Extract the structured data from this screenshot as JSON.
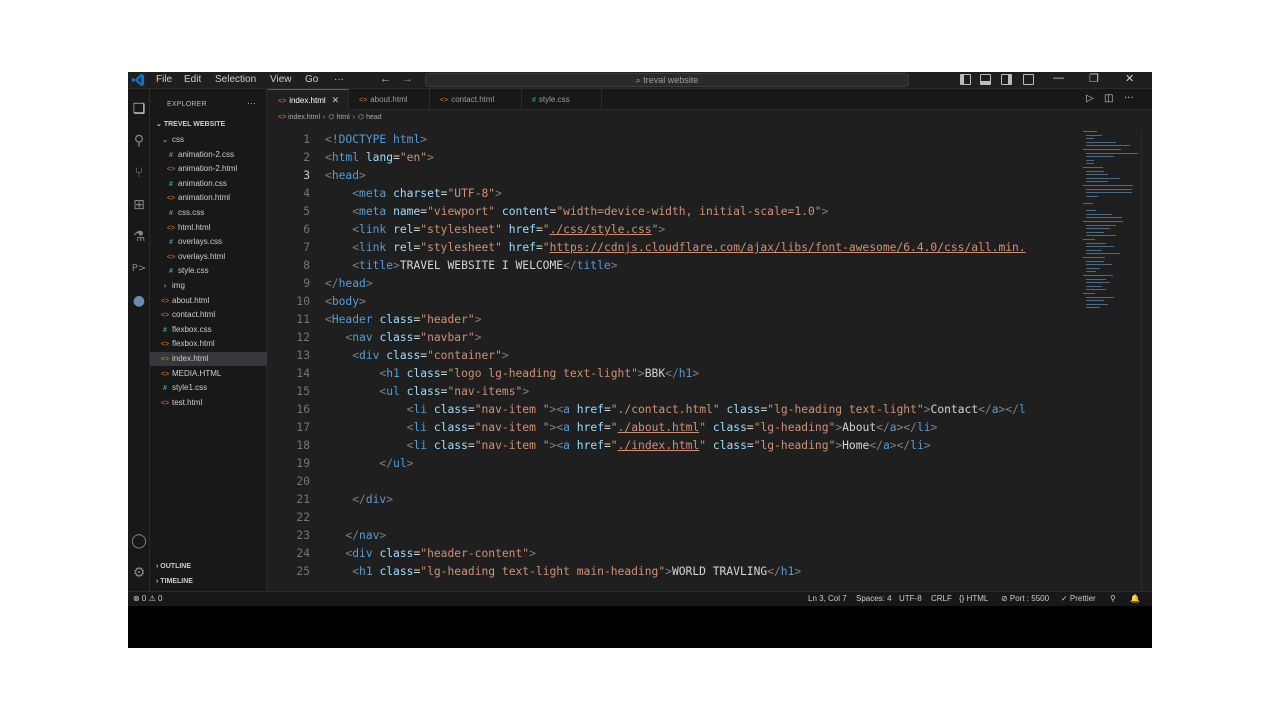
{
  "titlebar": {
    "menu": [
      "File",
      "Edit",
      "Selection",
      "View",
      "Go",
      "···"
    ],
    "search": "treval website"
  },
  "sidebar": {
    "header": "EXPLORER",
    "more": "···",
    "project": "TREVEL WEBSITE",
    "tree": [
      {
        "name": "css",
        "kind": "folder",
        "indent": 1
      },
      {
        "name": "animation-2.css",
        "kind": "css",
        "indent": 2
      },
      {
        "name": "animation-2.html",
        "kind": "html",
        "indent": 2
      },
      {
        "name": "animation.css",
        "kind": "css",
        "indent": 2
      },
      {
        "name": "animation.html",
        "kind": "html",
        "indent": 2
      },
      {
        "name": "css.css",
        "kind": "css",
        "indent": 2
      },
      {
        "name": "html.html",
        "kind": "html",
        "indent": 2
      },
      {
        "name": "overlays.css",
        "kind": "css",
        "indent": 2
      },
      {
        "name": "overlays.html",
        "kind": "html",
        "indent": 2
      },
      {
        "name": "style.css",
        "kind": "css",
        "indent": 2
      },
      {
        "name": "img",
        "kind": "folder-closed",
        "indent": 1
      },
      {
        "name": "about.html",
        "kind": "html",
        "indent": 1
      },
      {
        "name": "contact.html",
        "kind": "html",
        "indent": 1
      },
      {
        "name": "flexbox.css",
        "kind": "css",
        "indent": 1
      },
      {
        "name": "flexbox.html",
        "kind": "html",
        "indent": 1
      },
      {
        "name": "index.html",
        "kind": "html",
        "indent": 1,
        "selected": true
      },
      {
        "name": "MEDIA.HTML",
        "kind": "html",
        "indent": 1
      },
      {
        "name": "style1.css",
        "kind": "css",
        "indent": 1
      },
      {
        "name": "test.html",
        "kind": "html",
        "indent": 1
      }
    ],
    "outline": "OUTLINE",
    "timeline": "TIMELINE"
  },
  "tabs": [
    {
      "label": "index.html",
      "kind": "html",
      "active": true
    },
    {
      "label": "about.html",
      "kind": "html"
    },
    {
      "label": "contact.html",
      "kind": "html"
    },
    {
      "label": "style.css",
      "kind": "css"
    }
  ],
  "breadcrumb": [
    "index.html",
    "html",
    "head"
  ],
  "code": {
    "current_line": 3,
    "lines": [
      [
        [
          "br",
          "<"
        ],
        [
          "tag",
          "!DOCTYPE"
        ],
        [
          "txt",
          " "
        ],
        [
          "tag",
          "html"
        ],
        [
          "br",
          ">"
        ]
      ],
      [
        [
          "br",
          "<"
        ],
        [
          "tag",
          "html"
        ],
        [
          "txt",
          " "
        ],
        [
          "attr",
          "lang"
        ],
        [
          "txt",
          "="
        ],
        [
          "str",
          "\"en\""
        ],
        [
          "br",
          ">"
        ]
      ],
      [
        [
          "br",
          "<"
        ],
        [
          "tag",
          "head"
        ],
        [
          "br",
          ">"
        ]
      ],
      [
        [
          "txt",
          "    "
        ],
        [
          "br",
          "<"
        ],
        [
          "tag",
          "meta"
        ],
        [
          "txt",
          " "
        ],
        [
          "attr",
          "charset"
        ],
        [
          "txt",
          "="
        ],
        [
          "str",
          "\"UTF-8\""
        ],
        [
          "br",
          ">"
        ]
      ],
      [
        [
          "txt",
          "    "
        ],
        [
          "br",
          "<"
        ],
        [
          "tag",
          "meta"
        ],
        [
          "txt",
          " "
        ],
        [
          "attr",
          "name"
        ],
        [
          "txt",
          "="
        ],
        [
          "str",
          "\"viewport\""
        ],
        [
          "txt",
          " "
        ],
        [
          "attr",
          "content"
        ],
        [
          "txt",
          "="
        ],
        [
          "str",
          "\"width=device-width, initial-scale=1.0\""
        ],
        [
          "br",
          ">"
        ]
      ],
      [
        [
          "txt",
          "    "
        ],
        [
          "br",
          "<"
        ],
        [
          "tag",
          "link"
        ],
        [
          "txt",
          " "
        ],
        [
          "attr",
          "rel"
        ],
        [
          "txt",
          "="
        ],
        [
          "str",
          "\"stylesheet\""
        ],
        [
          "txt",
          " "
        ],
        [
          "attr",
          "href"
        ],
        [
          "txt",
          "="
        ],
        [
          "str",
          "\""
        ],
        [
          "strul",
          "./css/style.css"
        ],
        [
          "str",
          "\""
        ],
        [
          "br",
          ">"
        ]
      ],
      [
        [
          "txt",
          "    "
        ],
        [
          "br",
          "<"
        ],
        [
          "tag",
          "link"
        ],
        [
          "txt",
          " "
        ],
        [
          "attr",
          "rel"
        ],
        [
          "txt",
          "="
        ],
        [
          "str",
          "\"stylesheet\""
        ],
        [
          "txt",
          " "
        ],
        [
          "attr",
          "href"
        ],
        [
          "txt",
          "="
        ],
        [
          "str",
          "\""
        ],
        [
          "strul",
          "https://cdnjs.cloudflare.com/ajax/libs/font-awesome/6.4.0/css/all.min."
        ]
      ],
      [
        [
          "txt",
          "    "
        ],
        [
          "br",
          "<"
        ],
        [
          "tag",
          "title"
        ],
        [
          "br",
          ">"
        ],
        [
          "txt",
          "TRAVEL WEBSITE I WELCOME"
        ],
        [
          "br",
          "</"
        ],
        [
          "tag",
          "title"
        ],
        [
          "br",
          ">"
        ]
      ],
      [
        [
          "br",
          "</"
        ],
        [
          "tag",
          "head"
        ],
        [
          "br",
          ">"
        ]
      ],
      [
        [
          "br",
          "<"
        ],
        [
          "tag",
          "body"
        ],
        [
          "br",
          ">"
        ]
      ],
      [
        [
          "br",
          "<"
        ],
        [
          "tag",
          "Header"
        ],
        [
          "txt",
          " "
        ],
        [
          "attr",
          "class"
        ],
        [
          "txt",
          "="
        ],
        [
          "str",
          "\"header\""
        ],
        [
          "br",
          ">"
        ]
      ],
      [
        [
          "txt",
          "   "
        ],
        [
          "br",
          "<"
        ],
        [
          "tag",
          "nav"
        ],
        [
          "txt",
          " "
        ],
        [
          "attr",
          "class"
        ],
        [
          "txt",
          "="
        ],
        [
          "str",
          "\"navbar\""
        ],
        [
          "br",
          ">"
        ]
      ],
      [
        [
          "txt",
          "    "
        ],
        [
          "br",
          "<"
        ],
        [
          "tag",
          "div"
        ],
        [
          "txt",
          " "
        ],
        [
          "attr",
          "class"
        ],
        [
          "txt",
          "="
        ],
        [
          "str",
          "\"container\""
        ],
        [
          "br",
          ">"
        ]
      ],
      [
        [
          "txt",
          "        "
        ],
        [
          "br",
          "<"
        ],
        [
          "tag",
          "h1"
        ],
        [
          "txt",
          " "
        ],
        [
          "attr",
          "class"
        ],
        [
          "txt",
          "="
        ],
        [
          "str",
          "\"logo lg-heading text-light\""
        ],
        [
          "br",
          ">"
        ],
        [
          "txt",
          "BBK"
        ],
        [
          "br",
          "</"
        ],
        [
          "tag",
          "h1"
        ],
        [
          "br",
          ">"
        ]
      ],
      [
        [
          "txt",
          "        "
        ],
        [
          "br",
          "<"
        ],
        [
          "tag",
          "ul"
        ],
        [
          "txt",
          " "
        ],
        [
          "attr",
          "class"
        ],
        [
          "txt",
          "="
        ],
        [
          "str",
          "\"nav-items\""
        ],
        [
          "br",
          ">"
        ]
      ],
      [
        [
          "txt",
          "            "
        ],
        [
          "br",
          "<"
        ],
        [
          "tag",
          "li"
        ],
        [
          "txt",
          " "
        ],
        [
          "attr",
          "class"
        ],
        [
          "txt",
          "="
        ],
        [
          "str",
          "\"nav-item \""
        ],
        [
          "br",
          ">"
        ],
        [
          "br",
          "<"
        ],
        [
          "tag",
          "a"
        ],
        [
          "txt",
          " "
        ],
        [
          "attr",
          "href"
        ],
        [
          "txt",
          "="
        ],
        [
          "str",
          "\"./contact.html\""
        ],
        [
          "txt",
          " "
        ],
        [
          "attr",
          "class"
        ],
        [
          "txt",
          "="
        ],
        [
          "str",
          "\"lg-heading text-light\""
        ],
        [
          "br",
          ">"
        ],
        [
          "txt",
          "Contact"
        ],
        [
          "br",
          "</"
        ],
        [
          "tag",
          "a"
        ],
        [
          "br",
          "></"
        ],
        [
          "tag",
          "l"
        ]
      ],
      [
        [
          "txt",
          "            "
        ],
        [
          "br",
          "<"
        ],
        [
          "tag",
          "li"
        ],
        [
          "txt",
          " "
        ],
        [
          "attr",
          "class"
        ],
        [
          "txt",
          "="
        ],
        [
          "str",
          "\"nav-item \""
        ],
        [
          "br",
          ">"
        ],
        [
          "br",
          "<"
        ],
        [
          "tag",
          "a"
        ],
        [
          "txt",
          " "
        ],
        [
          "attr",
          "href"
        ],
        [
          "txt",
          "="
        ],
        [
          "str",
          "\""
        ],
        [
          "strul",
          "./about.html"
        ],
        [
          "str",
          "\""
        ],
        [
          "txt",
          " "
        ],
        [
          "attr",
          "class"
        ],
        [
          "txt",
          "="
        ],
        [
          "str",
          "\"lg-heading\""
        ],
        [
          "br",
          ">"
        ],
        [
          "txt",
          "About"
        ],
        [
          "br",
          "</"
        ],
        [
          "tag",
          "a"
        ],
        [
          "br",
          "></"
        ],
        [
          "tag",
          "li"
        ],
        [
          "br",
          ">"
        ]
      ],
      [
        [
          "txt",
          "            "
        ],
        [
          "br",
          "<"
        ],
        [
          "tag",
          "li"
        ],
        [
          "txt",
          " "
        ],
        [
          "attr",
          "class"
        ],
        [
          "txt",
          "="
        ],
        [
          "str",
          "\"nav-item \""
        ],
        [
          "br",
          ">"
        ],
        [
          "br",
          "<"
        ],
        [
          "tag",
          "a"
        ],
        [
          "txt",
          " "
        ],
        [
          "attr",
          "href"
        ],
        [
          "txt",
          "="
        ],
        [
          "str",
          "\""
        ],
        [
          "strul",
          "./index.html"
        ],
        [
          "str",
          "\""
        ],
        [
          "txt",
          " "
        ],
        [
          "attr",
          "class"
        ],
        [
          "txt",
          "="
        ],
        [
          "str",
          "\"lg-heading\""
        ],
        [
          "br",
          ">"
        ],
        [
          "txt",
          "Home"
        ],
        [
          "br",
          "</"
        ],
        [
          "tag",
          "a"
        ],
        [
          "br",
          "></"
        ],
        [
          "tag",
          "li"
        ],
        [
          "br",
          ">"
        ]
      ],
      [
        [
          "txt",
          "        "
        ],
        [
          "br",
          "</"
        ],
        [
          "tag",
          "ul"
        ],
        [
          "br",
          ">"
        ]
      ],
      [
        [
          "txt",
          ""
        ]
      ],
      [
        [
          "txt",
          "    "
        ],
        [
          "br",
          "</"
        ],
        [
          "tag",
          "div"
        ],
        [
          "br",
          ">"
        ]
      ],
      [
        [
          "txt",
          ""
        ]
      ],
      [
        [
          "txt",
          "   "
        ],
        [
          "br",
          "</"
        ],
        [
          "tag",
          "nav"
        ],
        [
          "br",
          ">"
        ]
      ],
      [
        [
          "txt",
          "   "
        ],
        [
          "br",
          "<"
        ],
        [
          "tag",
          "div"
        ],
        [
          "txt",
          " "
        ],
        [
          "attr",
          "class"
        ],
        [
          "txt",
          "="
        ],
        [
          "str",
          "\"header-content\""
        ],
        [
          "br",
          ">"
        ]
      ],
      [
        [
          "txt",
          "    "
        ],
        [
          "br",
          "<"
        ],
        [
          "tag",
          "h1"
        ],
        [
          "txt",
          " "
        ],
        [
          "attr",
          "class"
        ],
        [
          "txt",
          "="
        ],
        [
          "str",
          "\"lg-heading text-light main-heading\""
        ],
        [
          "br",
          ">"
        ],
        [
          "txt",
          "WORLD TRAVLING"
        ],
        [
          "br",
          "</"
        ],
        [
          "tag",
          "h1"
        ],
        [
          "br",
          ">"
        ]
      ]
    ]
  },
  "statusbar": {
    "problems": "⊗ 0 ⚠ 0",
    "position": "Ln 3, Col 7",
    "spaces": "Spaces: 4",
    "encoding": "UTF-8",
    "eol": "CRLF",
    "language": "{} HTML",
    "port": "⊘ Port : 5500",
    "prettier": "✓ Prettier"
  }
}
